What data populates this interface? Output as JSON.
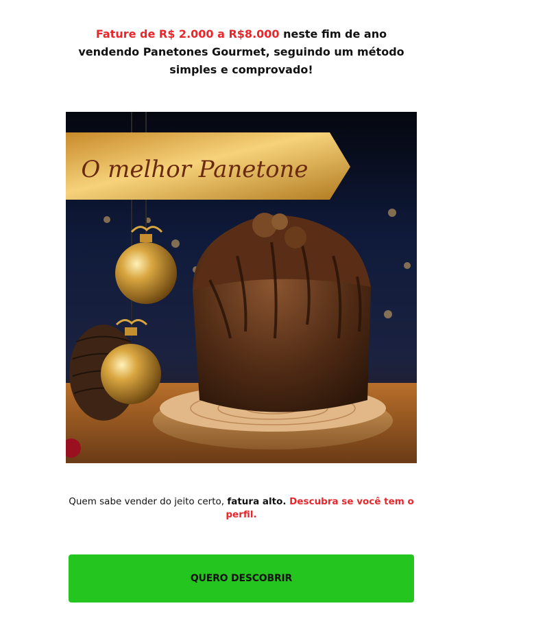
{
  "headline": {
    "highlight": "Fature de R$ 2.000 a R$8.000",
    "rest": " neste fim de ano vendendo Panetones Gourmet, seguindo um método simples e comprovado!"
  },
  "hero": {
    "banner_text": "O melhor Panetone"
  },
  "subtext": {
    "plain": "Quem sabe vender do jeito certo, ",
    "bold": "fatura alto.",
    "highlight": " Descubra se você tem o perfil."
  },
  "cta": {
    "label": "QUERO DESCOBRIR"
  },
  "colors": {
    "accent_red": "#e8262b",
    "cta_green": "#24c51f"
  }
}
